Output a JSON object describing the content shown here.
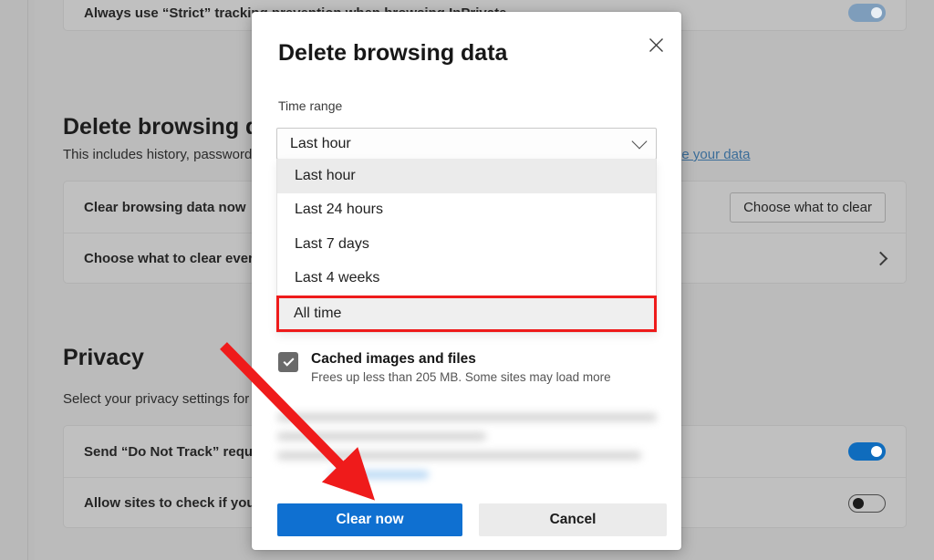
{
  "background": {
    "rows_top": [
      {
        "label": "Always use “Strict” tracking prevention when browsing InPrivate",
        "control": "toggle-on"
      }
    ],
    "delete_section": {
      "title": "Delete browsing data",
      "description": "This includes history, passwords, cookies, and more. Only data from this profile will be deleted.",
      "description_link": "Manage your data",
      "rows": [
        {
          "label": "Clear browsing data now",
          "button": "Choose what to clear"
        },
        {
          "label": "Choose what to clear every time you close the browser",
          "chevron": "chevron-right"
        }
      ]
    },
    "privacy_section": {
      "title": "Privacy",
      "description": "Select your privacy settings for Microsoft Edge",
      "rows": [
        {
          "label": "Send “Do Not Track” requests",
          "control": "toggle-on"
        },
        {
          "label": "Allow sites to check if you have payment methods saved",
          "control": "toggle-off"
        }
      ]
    }
  },
  "dialog": {
    "title": "Delete browsing data",
    "close_label": "✕",
    "time_range_label": "Time range",
    "selected_value": "Last hour",
    "options": [
      {
        "label": "Last hour",
        "state": "hovered"
      },
      {
        "label": "Last 24 hours",
        "state": "normal"
      },
      {
        "label": "Last 7 days",
        "state": "normal"
      },
      {
        "label": "Last 4 weeks",
        "state": "normal"
      },
      {
        "label": "All time",
        "state": "highlighted"
      }
    ],
    "checkbox": {
      "checked": true,
      "title": "Cached images and files",
      "subtitle": "Frees up less than 205 MB. Some sites may load more"
    },
    "primary_button": "Clear now",
    "secondary_button": "Cancel"
  },
  "annotation": {
    "arrow_color": "#ef1b1b",
    "highlight_color": "#ee1b1b"
  }
}
